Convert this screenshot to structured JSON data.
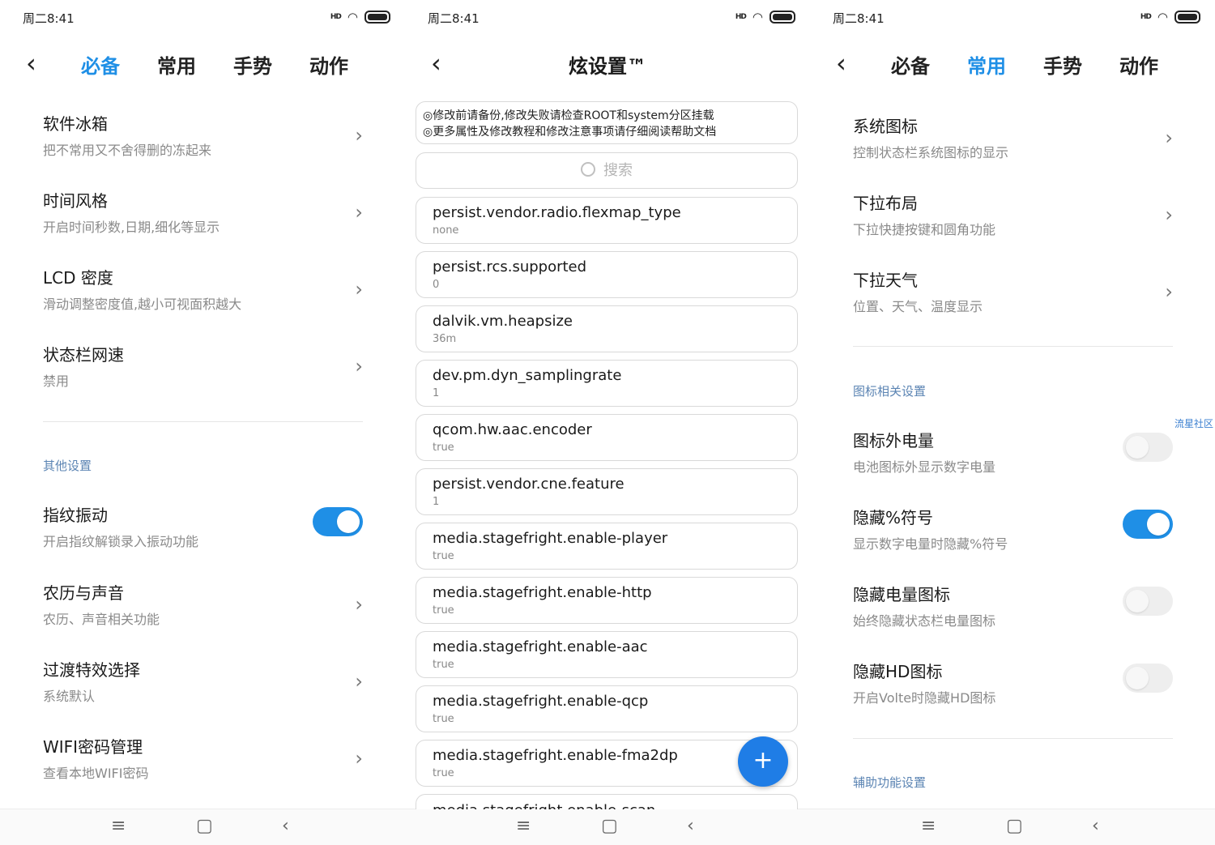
{
  "status": {
    "time": "周二8:41",
    "signal": "HD"
  },
  "panel1": {
    "tabs": [
      "必备",
      "常用",
      "手势",
      "动作"
    ],
    "items_top": [
      {
        "title": "软件冰箱",
        "subtitle": "把不常用又不舍得删的冻起来"
      },
      {
        "title": "时间风格",
        "subtitle": "开启时间秒数,日期,细化等显示"
      },
      {
        "title": "LCD 密度",
        "subtitle": "滑动调整密度值,越小可视面积越大"
      },
      {
        "title": "状态栏网速",
        "subtitle": "禁用"
      }
    ],
    "section": "其他设置",
    "toggle_item": {
      "title": "指纹振动",
      "subtitle": "开启指纹解锁录入振动功能",
      "on": true
    },
    "items_bottom": [
      {
        "title": "农历与声音",
        "subtitle": "农历、声音相关功能"
      },
      {
        "title": "过渡特效选择",
        "subtitle": "系统默认"
      },
      {
        "title": "WIFI密码管理",
        "subtitle": "查看本地WIFI密码"
      }
    ]
  },
  "panel2": {
    "title": "炫设置™",
    "notice_lines": [
      "◎修改前请备份,修改失败请检查ROOT和system分区挂载",
      "◎更多属性及修改教程和修改注意事项请仔细阅读帮助文档"
    ],
    "search_placeholder": "搜索",
    "props": [
      {
        "key": "persist.vendor.radio.flexmap_type",
        "value": "none"
      },
      {
        "key": "persist.rcs.supported",
        "value": "0"
      },
      {
        "key": "dalvik.vm.heapsize",
        "value": "36m"
      },
      {
        "key": "dev.pm.dyn_samplingrate",
        "value": "1"
      },
      {
        "key": "qcom.hw.aac.encoder",
        "value": "true"
      },
      {
        "key": "persist.vendor.cne.feature",
        "value": "1"
      },
      {
        "key": "media.stagefright.enable-player",
        "value": "true"
      },
      {
        "key": "media.stagefright.enable-http",
        "value": "true"
      },
      {
        "key": "media.stagefright.enable-aac",
        "value": "true"
      },
      {
        "key": "media.stagefright.enable-qcp",
        "value": "true"
      },
      {
        "key": "media.stagefright.enable-fma2dp",
        "value": "true"
      },
      {
        "key": "media.stagefright.enable-scan",
        "value": ""
      }
    ],
    "fab_label": "+"
  },
  "panel3": {
    "tabs": [
      "必备",
      "常用",
      "手势",
      "动作"
    ],
    "items_top": [
      {
        "title": "系统图标",
        "subtitle": "控制状态栏系统图标的显示"
      },
      {
        "title": "下拉布局",
        "subtitle": "下拉快捷按键和圆角功能"
      },
      {
        "title": "下拉天气",
        "subtitle": "位置、天气、温度显示"
      }
    ],
    "section": "图标相关设置",
    "toggles": [
      {
        "title": "图标外电量",
        "subtitle": "电池图标外显示数字电量",
        "on": false
      },
      {
        "title": "隐藏%符号",
        "subtitle": "显示数字电量时隐藏%符号",
        "on": true
      },
      {
        "title": "隐藏电量图标",
        "subtitle": "始终隐藏状态栏电量图标",
        "on": false
      },
      {
        "title": "隐藏HD图标",
        "subtitle": "开启Volte时隐藏HD图标",
        "on": false
      }
    ],
    "section2": "辅助功能设置"
  },
  "watermark": "流星社区",
  "nav": {
    "menu": "≡",
    "home": "▢",
    "back": "‹"
  },
  "colors": {
    "accent": "#1f8fe6",
    "fab": "#1f7de6",
    "section": "#5b84b3"
  }
}
